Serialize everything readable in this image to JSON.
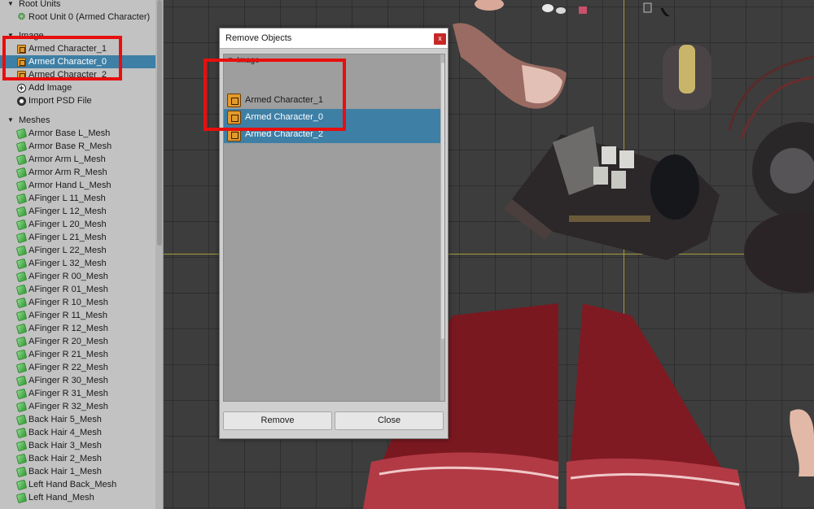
{
  "hierarchy": {
    "root_units_label": "Root Units",
    "root_unit_item": "Root Unit 0 (Armed Character)",
    "image_label": "Image",
    "images": [
      "Armed Character_1",
      "Armed Character_0",
      "Armed Character_2"
    ],
    "selected_image": "Armed Character_0",
    "add_image_label": "Add Image",
    "import_psd_label": "Import PSD File",
    "meshes_label": "Meshes",
    "meshes": [
      "Armor Base L_Mesh",
      "Armor Base R_Mesh",
      "Armor Arm L_Mesh",
      "Armor Arm R_Mesh",
      "Armor Hand L_Mesh",
      "AFinger L 11_Mesh",
      "AFinger L 12_Mesh",
      "AFinger L 20_Mesh",
      "AFinger L 21_Mesh",
      "AFinger L 22_Mesh",
      "AFinger L 32_Mesh",
      "AFinger R 00_Mesh",
      "AFinger R 01_Mesh",
      "AFinger R 10_Mesh",
      "AFinger R 11_Mesh",
      "AFinger R 12_Mesh",
      "AFinger R 20_Mesh",
      "AFinger R 21_Mesh",
      "AFinger R 22_Mesh",
      "AFinger R 30_Mesh",
      "AFinger R 31_Mesh",
      "AFinger R 32_Mesh",
      "Back Hair 5_Mesh",
      "Back Hair 4_Mesh",
      "Back Hair 3_Mesh",
      "Back Hair 2_Mesh",
      "Back Hair 1_Mesh",
      "Left Hand Back_Mesh",
      "Left Hand_Mesh"
    ]
  },
  "dialog": {
    "title": "Remove Objects",
    "close_glyph": "x",
    "list_header": "Image",
    "items": [
      {
        "label": "Armed Character_1",
        "selected": false
      },
      {
        "label": "Armed Character_0",
        "selected": true
      },
      {
        "label": "Armed Character_2",
        "selected": true
      }
    ],
    "remove_label": "Remove",
    "close_label": "Close"
  },
  "colors": {
    "selection": "#3e7fa6",
    "highlight_box": "#e80e0e",
    "panel_bg": "#c2c2c2",
    "viewport_bg": "#3d3d3d",
    "axis_line": "#a69a3a"
  }
}
